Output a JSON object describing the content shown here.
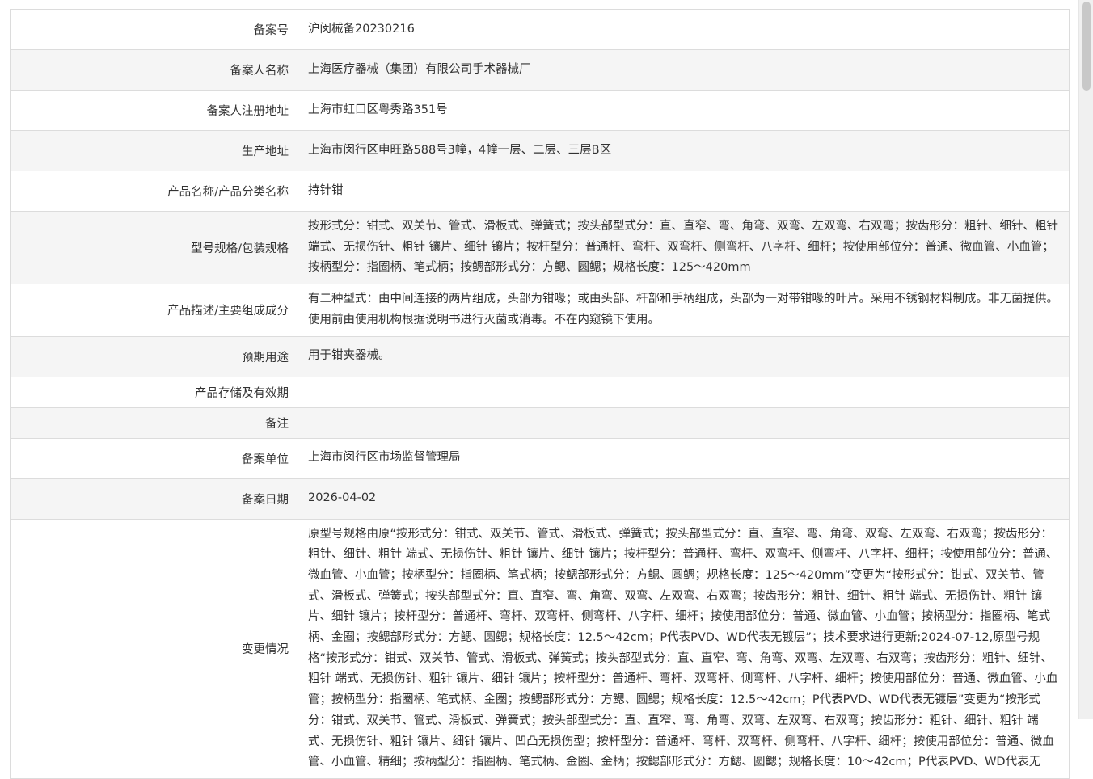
{
  "record": {
    "rows": [
      {
        "label": "备案号",
        "value": "沪闵械备20230216"
      },
      {
        "label": "备案人名称",
        "value": "上海医疗器械（集团）有限公司手术器械厂"
      },
      {
        "label": "备案人注册地址",
        "value": "上海市虹口区粤秀路351号"
      },
      {
        "label": "生产地址",
        "value": "上海市闵行区申旺路588号3幢，4幢一层、二层、三层B区"
      },
      {
        "label": "产品名称/产品分类名称",
        "value": "持针钳"
      },
      {
        "label": "型号规格/包装规格",
        "value": "按形式分：钳式、双关节、管式、滑板式、弹簧式；按头部型式分：直、直窄、弯、角弯、双弯、左双弯、右双弯；按齿形分：粗针、细针、粗针 端式、无损伤针、粗针 镶片、细针 镶片；按杆型分：普通杆、弯杆、双弯杆、侧弯杆、八字杆、细杆；按使用部位分：普通、微血管、小血管；按柄型分：指圈柄、笔式柄；按鳃部形式分：方鳃、圆鳃；规格长度：125～420mm"
      },
      {
        "label": "产品描述/主要组成成分",
        "value": "有二种型式：由中间连接的两片组成，头部为钳喙；或由头部、杆部和手柄组成，头部为一对带钳喙的叶片。采用不锈钢材料制成。非无菌提供。使用前由使用机构根据说明书进行灭菌或消毒。不在内窥镜下使用。"
      },
      {
        "label": "预期用途",
        "value": "用于钳夹器械。"
      },
      {
        "label": "产品存储及有效期",
        "value": ""
      },
      {
        "label": "备注",
        "value": ""
      },
      {
        "label": "备案单位",
        "value": "上海市闵行区市场监督管理局"
      },
      {
        "label": "备案日期",
        "value": "2026-04-02"
      },
      {
        "label": "变更情况",
        "value": "原型号规格由原“按形式分：钳式、双关节、管式、滑板式、弹簧式；按头部型式分：直、直窄、弯、角弯、双弯、左双弯、右双弯；按齿形分：粗针、细针、粗针 端式、无损伤针、粗针 镶片、细针 镶片；按杆型分：普通杆、弯杆、双弯杆、侧弯杆、八字杆、细杆；按使用部位分：普通、微血管、小血管；按柄型分：指圈柄、笔式柄；按鳃部形式分：方鳃、圆鳃；规格长度：125～420mm”变更为“按形式分：钳式、双关节、管式、滑板式、弹簧式；按头部型式分：直、直窄、弯、角弯、双弯、左双弯、右双弯；按齿形分：粗针、细针、粗针 端式、无损伤针、粗针 镶片、细针 镶片；按杆型分：普通杆、弯杆、双弯杆、侧弯杆、八字杆、细杆；按使用部位分：普通、微血管、小血管；按柄型分：指圈柄、笔式柄、金圈；按鳃部形式分：方鳃、圆鳃；规格长度：12.5～42cm；P代表PVD、WD代表无镀层”；技术要求进行更新;2024-07-12,原型号规格“按形式分：钳式、双关节、管式、滑板式、弹簧式；按头部型式分：直、直窄、弯、角弯、双弯、左双弯、右双弯；按齿形分：粗针、细针、粗针 端式、无损伤针、粗针 镶片、细针 镶片；按杆型分：普通杆、弯杆、双弯杆、侧弯杆、八字杆、细杆；按使用部位分：普通、微血管、小血管；按柄型分：指圈柄、笔式柄、金圈；按鳃部形式分：方鳃、圆鳃；规格长度：12.5～42cm；P代表PVD、WD代表无镀层”变更为“按形式分：钳式、双关节、管式、滑板式、弹簧式；按头部型式分：直、直窄、弯、角弯、双弯、左双弯、右双弯；按齿形分：粗针、细针、粗针 端式、无损伤针、粗针 镶片、细针 镶片、凹凸无损伤型；按杆型分：普通杆、弯杆、双弯杆、侧弯杆、八字杆、细杆；按使用部位分：普通、微血管、小血管、精细；按柄型分：指圈柄、笔式柄、金圈、金柄；按鳃部形式分：方鳃、圆鳃；规格长度：10～42cm；P代表PVD、WD代表无"
      }
    ]
  }
}
